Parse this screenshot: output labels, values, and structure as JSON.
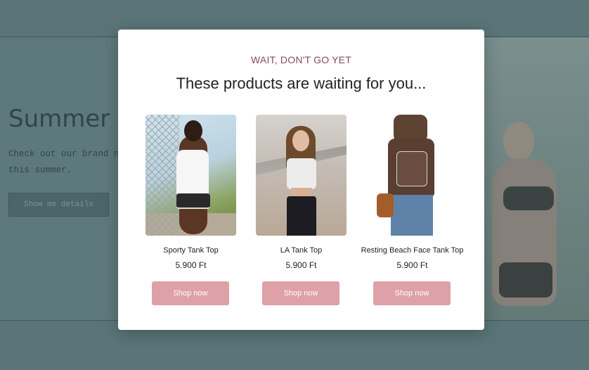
{
  "background_page": {
    "title": "Summer '",
    "text": "Check out our brand n this summer.",
    "button_label": "Show me details"
  },
  "modal": {
    "eyebrow": "WAIT, DON'T GO YET",
    "headline": "These products are waiting for you...",
    "products": [
      {
        "name": "Sporty Tank Top",
        "price": "5.900 Ft",
        "button": "Shop now"
      },
      {
        "name": "LA Tank Top",
        "price": "5.900 Ft",
        "button": "Shop now"
      },
      {
        "name": "Resting Beach Face Tank Top",
        "price": "5.900 Ft",
        "button": "Shop now"
      }
    ]
  },
  "colors": {
    "overlay": "#5f7b80",
    "accent_button": "#dda1a7",
    "eyebrow": "#8a4a56"
  }
}
